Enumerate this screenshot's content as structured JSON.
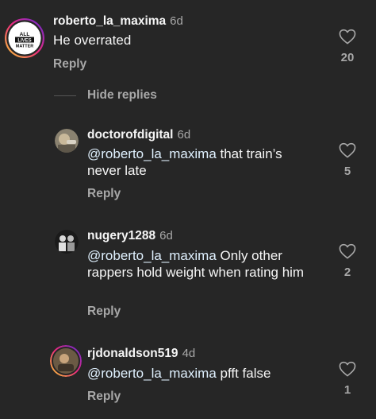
{
  "comments": [
    {
      "username": "roberto_la_maxima",
      "time": "6d",
      "text": "He overrated",
      "reply_label": "Reply",
      "likes": "20",
      "avatar_text": [
        "ALL",
        "LIVES",
        "MATTER"
      ]
    },
    {
      "username": "doctorofdigital",
      "time": "6d",
      "mention": "@roberto_la_maxima",
      "text": " that train’s never late",
      "reply_label": "Reply",
      "likes": "5"
    },
    {
      "username": "nugery1288",
      "time": "6d",
      "mention": "@roberto_la_maxima",
      "text": " Only other rappers hold weight when rating him",
      "reply_label": "Reply",
      "likes": "2"
    },
    {
      "username": "rjdonaldson519",
      "time": "4d",
      "mention": "@roberto_la_maxima",
      "text": " pfft false",
      "reply_label": "Reply",
      "likes": "1"
    }
  ],
  "hide_replies_label": "Hide replies",
  "colors": {
    "background": "#262626",
    "story_ring_start": "#f9ce34",
    "story_ring_end": "#c13584",
    "secondary_text": "#a8a8a8"
  }
}
